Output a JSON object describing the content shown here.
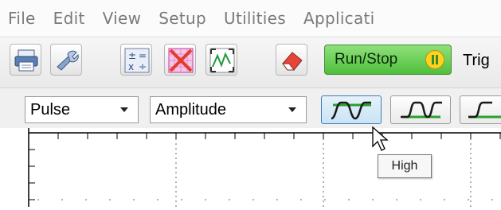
{
  "menu": {
    "items": [
      "File",
      "Edit",
      "View",
      "Setup",
      "Utilities",
      "Applicati"
    ]
  },
  "toolbar": {
    "icons": [
      "printer-icon",
      "wrench-icon",
      "calculator-icon",
      "chart-grid-icon",
      "zoom-fit-icon",
      "eraser-icon"
    ],
    "run_stop_label": "Run/Stop",
    "trigger_label_partial": "Trig"
  },
  "controls": {
    "measurement_type": "Pulse",
    "measurement_param": "Amplitude",
    "waveform_buttons": [
      "high-pulse-icon",
      "low-pulse-icon",
      "rise-icon"
    ]
  },
  "tooltip": {
    "text": "High"
  },
  "colors": {
    "run_green": "#4fbf3b",
    "waveform_stroke": "#1a1a1a",
    "waveform_level": "#2aa02a",
    "active_button": "#c9e3f6"
  }
}
